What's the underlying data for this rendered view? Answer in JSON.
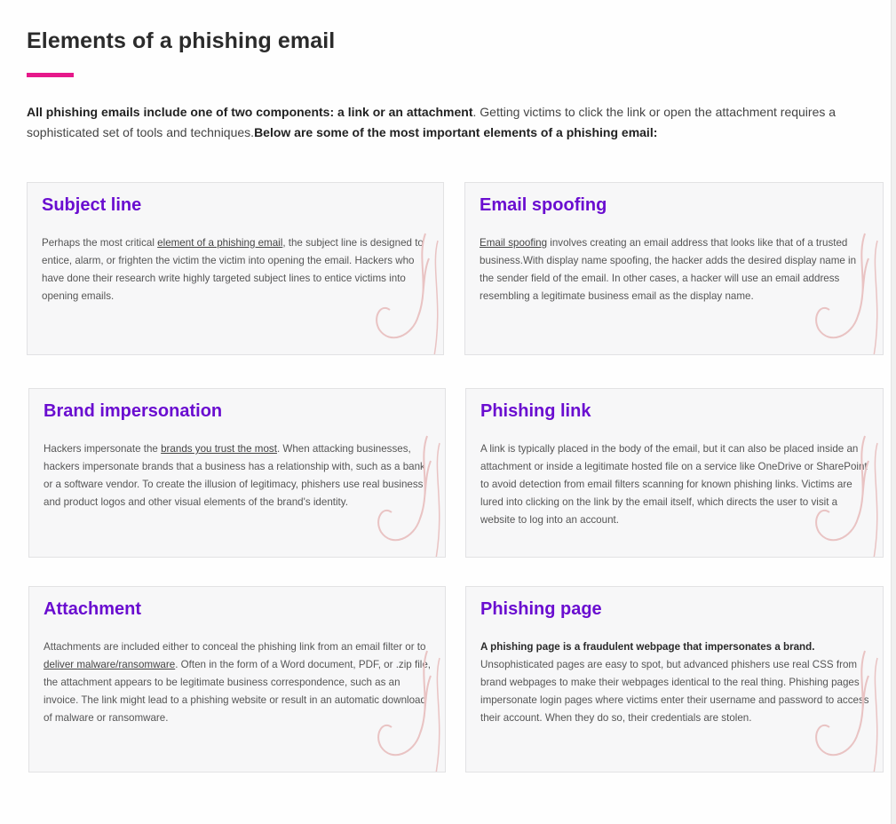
{
  "article": {
    "title": "Elements of a phishing email",
    "intro": {
      "bold_lead": "All phishing emails include one of two components: a link or an attachment",
      "text": ". Getting victims to click the link or open the attachment requires a sophisticated set of tools and techniques.",
      "bold_tail": "Below are some of the most important elements of a phishing email:"
    }
  },
  "cards": [
    {
      "title": "Subject line",
      "before": "Perhaps the most critical ",
      "link": "element of a phishing email",
      "after": ", the subject line is designed to entice, alarm, or frighten the victim the victim into opening the email. Hackers who have done their research write highly targeted subject lines to entice victims into opening emails."
    },
    {
      "title": "Email spoofing",
      "link": "Email spoofing",
      "after": " involves creating an email address that looks like that of a trusted business.",
      "after2": "With display name spoofing, the hacker adds the desired display name in the sender field of the email. In other cases, a hacker will use an email address resembling a legitimate business email as the display name."
    },
    {
      "title": "Brand impersonation",
      "before": "Hackers impersonate the ",
      "link": "brands you trust the most",
      "after": ". When attacking businesses, hackers impersonate brands that a business has a relationship with, such as a bank or a software vendor. To create the illusion of legitimacy, phishers use real business and product logos and other visual elements of the brand's identity."
    },
    {
      "title": "Phishing link",
      "text": "A link is typically placed in the body of the email, but it can also be placed inside an attachment or inside a legitimate hosted file on a service like OneDrive or SharePoint to avoid detection from email filters scanning for known phishing links. Victims are lured into clicking on the link by the email itself, which directs the user to visit a website to log into an account."
    },
    {
      "title": "Attachment",
      "before": "Attachments are included either to conceal the phishing link from an email filter or to ",
      "link": "deliver malware/ransomware",
      "after": ". Often in the form of a Word document, PDF, or .zip file, the attachment appears to be legitimate business correspondence, such as an invoice. The link might lead to a phishing website or result in an automatic download of malware or ransomware."
    },
    {
      "title": "Phishing page",
      "bold": "A phishing page is a fraudulent webpage that impersonates a brand.",
      "after": " Unsophisticated pages are easy to spot, but advanced phishers use real CSS from brand webpages to make their webpages identical to the real thing. Phishing pages impersonate login pages where victims enter their username and password to access their account. When they do so, their credentials are stolen."
    }
  ],
  "colors": {
    "accent": "#e6188a",
    "card_title": "#6a0dd0",
    "hook": "#e9c3c3"
  },
  "icons": {
    "card_decoration": "fishing-hook-icon"
  }
}
